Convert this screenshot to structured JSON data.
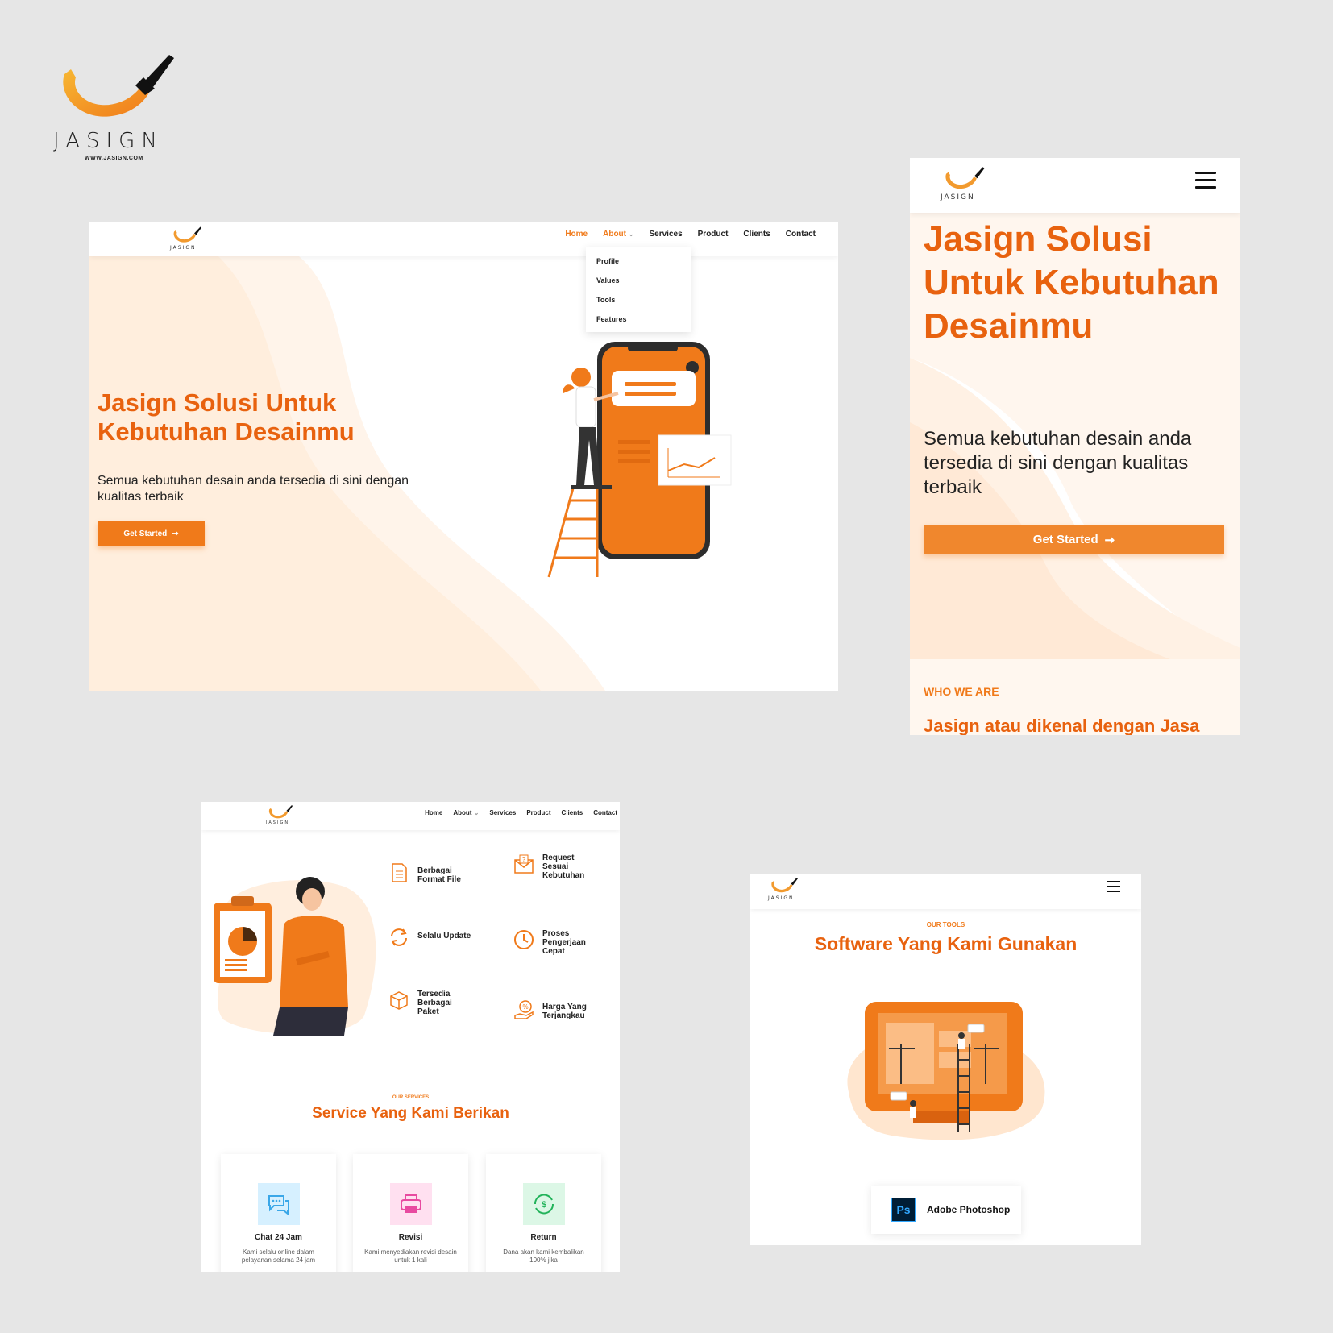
{
  "brand": {
    "wordmark": "JASIGN",
    "url": "WWW.JASIGN.COM",
    "colors": {
      "orange": "#f07a1a",
      "heading_orange": "#e8620f",
      "cream": "#fff1e3"
    }
  },
  "desktop": {
    "nav": {
      "logo_text": "JASIGN",
      "items": [
        "Home",
        "About",
        "Services",
        "Product",
        "Clients",
        "Contact"
      ],
      "active": "Home",
      "dropdown_chevron": "⌄"
    },
    "dropdown": [
      "Profile",
      "Values",
      "Tools",
      "Features"
    ],
    "hero": {
      "title": "Jasign Solusi Untuk Kebutuhan Desainmu",
      "subtitle": "Semua kebutuhan desain anda tersedia di sini dengan kualitas terbaik",
      "cta": "Get Started",
      "cta_icon": "arrow-right-icon"
    }
  },
  "mobile": {
    "nav": {
      "logo_text": "JASIGN",
      "menu_icon": "hamburger-icon"
    },
    "hero": {
      "title": "Jasign Solusi Untuk Kebutuhan Desainmu",
      "subtitle": "Semua kebutuhan desain anda tersedia di sini dengan kualitas terbaik",
      "cta": "Get Started"
    },
    "who_label": "WHO WE ARE",
    "who_heading": "Jasign atau dikenal dengan Jasa"
  },
  "features": {
    "nav": {
      "logo_text": "JASIGN",
      "items": [
        "Home",
        "About",
        "Services",
        "Product",
        "Clients",
        "Contact"
      ]
    },
    "items": [
      {
        "label": "Berbagai Format File",
        "icon": "document-icon"
      },
      {
        "label": "Request Sesuai Kebutuhan",
        "icon": "request-icon"
      },
      {
        "label": "Selalu Update",
        "icon": "refresh-icon"
      },
      {
        "label": "Proses Pengerjaan Cepat",
        "icon": "clock-icon"
      },
      {
        "label": "Tersedia Berbagai Paket",
        "icon": "box-icon"
      },
      {
        "label": "Harga Yang Terjangkau",
        "icon": "price-icon"
      }
    ],
    "services_label": "OUR SERVICES",
    "services_heading": "Service Yang Kami Berikan",
    "cards": [
      {
        "title": "Chat 24 Jam",
        "desc": "Kami selalu online dalam pelayanan selama 24 jam",
        "icon": "chat-icon",
        "bg": "#d6f0ff",
        "fg": "#3aa7e8"
      },
      {
        "title": "Revisi",
        "desc": "Kami menyediakan revisi desain untuk 1 kali",
        "icon": "print-icon",
        "bg": "#ffe0f0",
        "fg": "#e84aa0"
      },
      {
        "title": "Return",
        "desc": "Dana akan kami kembalikan 100% jika",
        "icon": "money-return-icon",
        "bg": "#dcf7e6",
        "fg": "#22b35a"
      }
    ]
  },
  "tools": {
    "nav": {
      "logo_text": "JASIGN",
      "menu_icon": "hamburger-icon"
    },
    "label": "OUR TOOLS",
    "heading": "Software Yang Kami Gunakan",
    "software": {
      "name": "Adobe Photoshop",
      "icon_text": "Ps"
    }
  }
}
